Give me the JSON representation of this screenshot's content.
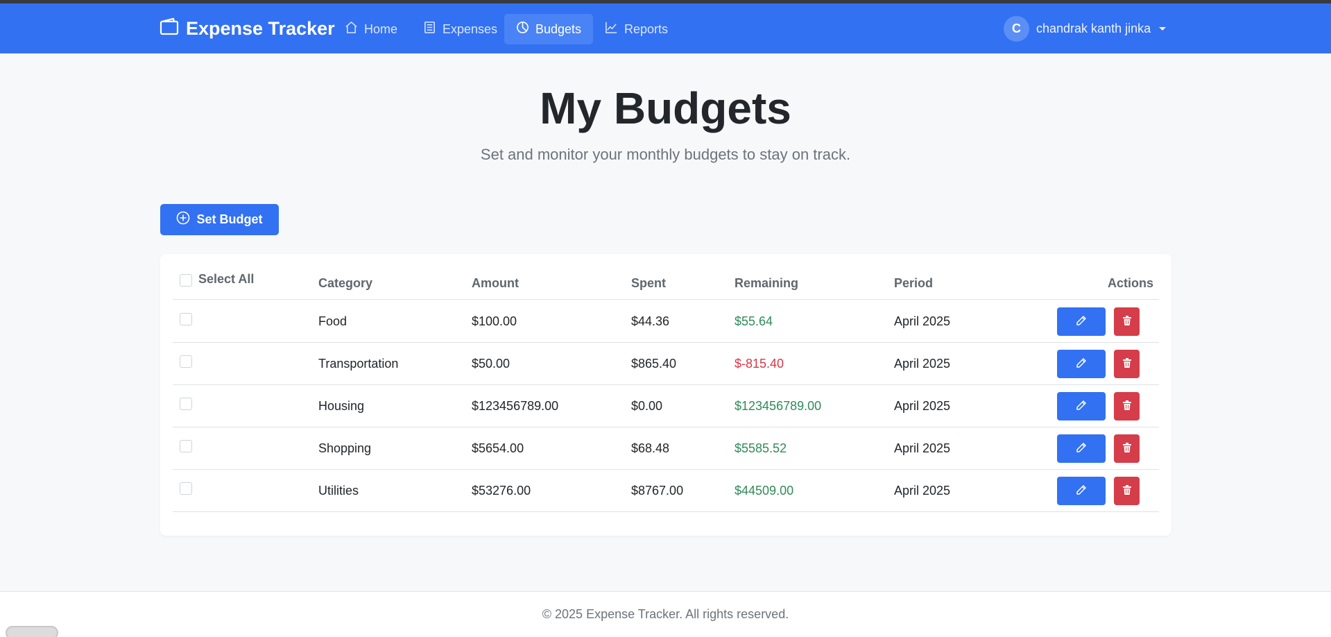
{
  "app": {
    "name": "Expense Tracker"
  },
  "nav": {
    "items": [
      {
        "label": "Home",
        "icon": "home-icon"
      },
      {
        "label": "Expenses",
        "icon": "list-icon"
      },
      {
        "label": "Budgets",
        "icon": "pie-chart-icon",
        "active": true
      },
      {
        "label": "Reports",
        "icon": "line-chart-icon"
      }
    ]
  },
  "user": {
    "initial": "C",
    "name": "chandrak kanth jinka"
  },
  "page": {
    "title": "My Budgets",
    "subtitle": "Set and monitor your monthly budgets to stay on track."
  },
  "actions": {
    "set_budget_label": "Set Budget"
  },
  "table": {
    "select_all_label": "Select All",
    "headers": {
      "category": "Category",
      "amount": "Amount",
      "spent": "Spent",
      "remaining": "Remaining",
      "period": "Period",
      "actions": "Actions"
    },
    "rows": [
      {
        "category": "Food",
        "amount": "$100.00",
        "spent": "$44.36",
        "remaining": "$55.64",
        "remaining_status": "positive",
        "period": "April 2025"
      },
      {
        "category": "Transportation",
        "amount": "$50.00",
        "spent": "$865.40",
        "remaining": "$-815.40",
        "remaining_status": "negative",
        "period": "April 2025"
      },
      {
        "category": "Housing",
        "amount": "$123456789.00",
        "spent": "$0.00",
        "remaining": "$123456789.00",
        "remaining_status": "positive",
        "period": "April 2025"
      },
      {
        "category": "Shopping",
        "amount": "$5654.00",
        "spent": "$68.48",
        "remaining": "$5585.52",
        "remaining_status": "positive",
        "period": "April 2025"
      },
      {
        "category": "Utilities",
        "amount": "$53276.00",
        "spent": "$8767.00",
        "remaining": "$44509.00",
        "remaining_status": "positive",
        "period": "April 2025"
      }
    ]
  },
  "footer": {
    "text": "© 2025 Expense Tracker. All rights reserved."
  },
  "colors": {
    "primary": "#3271f2",
    "danger": "#d43d49",
    "positive": "#2e8b57",
    "negative": "#dc3545"
  }
}
